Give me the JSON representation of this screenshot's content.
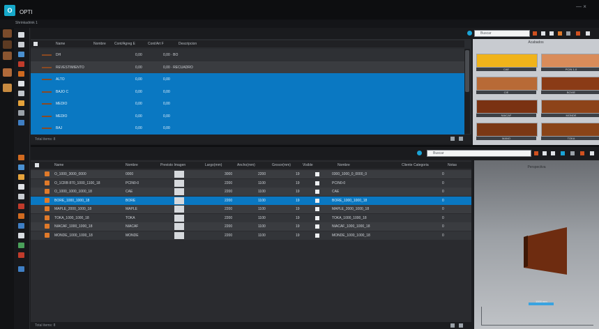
{
  "app": {
    "title": "OPTI",
    "logo_text": "O",
    "menu_label": "Shrinkadrink 1"
  },
  "window": {
    "controls": "— ×"
  },
  "top_grid": {
    "columns": [
      "Name",
      "Nombre",
      "Cont/Agreg E",
      "Cont/Art F",
      "Descripcion"
    ],
    "rows": [
      {
        "name": "DH",
        "c1": "",
        "c2": "0,00",
        "c3": "0,00 · BO",
        "selected": false,
        "style": "norm"
      },
      {
        "name": "REVESTIMIENTO",
        "c1": "",
        "c2": "0,00",
        "c3": "0,00 · RECUADRO",
        "selected": false,
        "style": "alt"
      },
      {
        "name": "ALTO",
        "c1": "",
        "c2": "0,00",
        "c3": "0,00",
        "selected": true,
        "style": "sel"
      },
      {
        "name": "BAJO C",
        "c1": "",
        "c2": "0,00",
        "c3": "0,00",
        "selected": true,
        "style": "sel"
      },
      {
        "name": "MEDIO",
        "c1": "",
        "c2": "0,00",
        "c3": "0,00",
        "selected": true,
        "style": "sel"
      },
      {
        "name": "MEDIO",
        "c1": "",
        "c2": "0,00",
        "c3": "0,00",
        "selected": true,
        "style": "sel"
      },
      {
        "name": "BAJ",
        "c1": "",
        "c2": "0,00",
        "c3": "0,00",
        "selected": true,
        "style": "sel"
      }
    ],
    "status": "Total items: 8"
  },
  "preview_top": {
    "title": "Acabados",
    "tiles": [
      {
        "label": "CAE",
        "color": "#f0b31a"
      },
      {
        "label": "PCIN 1-0",
        "color": "#d98c5a"
      },
      {
        "label": "CIE",
        "color": "#b86a36"
      },
      {
        "label": "BOVIE",
        "color": "#8a3b16"
      },
      {
        "label": "NIACAF",
        "color": "#7a3212"
      },
      {
        "label": "MONDE",
        "color": "#8d4319"
      },
      {
        "label": "MANO",
        "color": "#7b3815"
      },
      {
        "label": "TOKA",
        "color": "#8a4418"
      }
    ]
  },
  "search": {
    "placeholder": "Buscar"
  },
  "bottom_grid": {
    "columns": [
      "Name",
      "Nombre",
      "Previsto Imagen",
      "Largo(mm)",
      "Ancho(mm)",
      "Grosor(mm)",
      "Visible",
      "Nombre",
      "Cliente Categoria",
      "Notas"
    ],
    "rows": [
      {
        "name": "O_1000_3000_0000",
        "n": "0000",
        "l": "3000",
        "a": "2200",
        "g": "19",
        "desc": "0300_1000_0_0000_0",
        "q": "0",
        "selected": false
      },
      {
        "name": "O_1CRB 870_1000_1100_18",
        "n": "PCIN0-0",
        "l": "2200",
        "a": "1100",
        "g": "19",
        "desc": "PCIN0-0",
        "q": "0",
        "selected": false
      },
      {
        "name": "O_1000_1000_1000_18",
        "n": "CAE",
        "l": "2200",
        "a": "1100",
        "g": "19",
        "desc": "CAE",
        "q": "0",
        "selected": false
      },
      {
        "name": "BORE_1000_1000_18",
        "n": "BORE",
        "l": "2200",
        "a": "1100",
        "g": "19",
        "desc": "BORE_1000_1000_18",
        "q": "0",
        "selected": true
      },
      {
        "name": "MAPLE_2000_1000_18",
        "n": "MAPLE",
        "l": "2200",
        "a": "1100",
        "g": "19",
        "desc": "MAPLE_2000_1000_18",
        "q": "0",
        "selected": false
      },
      {
        "name": "TOKA_1000_1000_18",
        "n": "TOKA",
        "l": "2200",
        "a": "1100",
        "g": "19",
        "desc": "TOKA_1000_1000_18",
        "q": "0",
        "selected": false
      },
      {
        "name": "NIACAF_1000_1000_18",
        "n": "NIACAF",
        "l": "2200",
        "a": "1100",
        "g": "19",
        "desc": "NIACAF_1000_1000_18",
        "q": "0",
        "selected": false
      },
      {
        "name": "MONDE_1000_1000_18",
        "n": "MONDE",
        "l": "2200",
        "a": "1100",
        "g": "19",
        "desc": "MONDE_1000_1000_18",
        "q": "0",
        "selected": false
      }
    ],
    "status": "Total items: 8"
  },
  "viewer": {
    "title": "Perspectiva",
    "axis_label": "1000 mm"
  },
  "colors": {
    "accent": "#0a78c2",
    "panel": "#2a2c30",
    "logo": "#16a8c9",
    "wood": "#6e2c10"
  },
  "left_toolbar": {
    "icons": [
      "folder-icon",
      "brush-icon",
      "palette-icon",
      "wood-icon",
      "tools-icon"
    ]
  },
  "side_icons": {
    "icons": [
      "new-icon",
      "open-icon",
      "save-icon",
      "delete-icon",
      "cut-icon",
      "copy-icon",
      "print-icon",
      "chart-icon",
      "settings-icon",
      "info-icon"
    ]
  }
}
